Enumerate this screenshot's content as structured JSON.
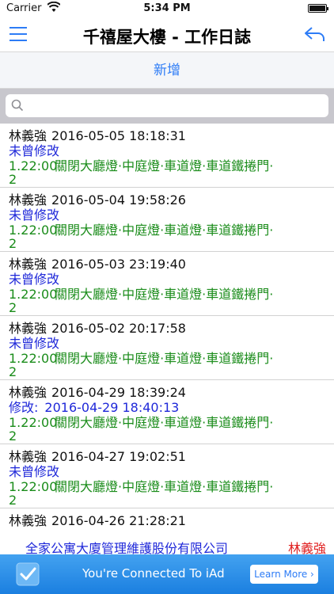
{
  "status_bar": {
    "carrier": "Carrier",
    "time": "5:34 PM"
  },
  "nav": {
    "title": "千禧屋大樓 - 工作日誌"
  },
  "add_button": "新增",
  "search": {
    "placeholder": ""
  },
  "entries": [
    {
      "name": "林義強",
      "datetime": "2016-05-05 18:18:31",
      "mod_label": "未曾修改",
      "mod_time": "",
      "version": "1.22:00",
      "task": "關閉大廳燈·中庭燈·車道燈·車道鐵捲門·",
      "count": "2"
    },
    {
      "name": "林義強",
      "datetime": "2016-05-04 19:58:26",
      "mod_label": "未曾修改",
      "mod_time": "",
      "version": "1.22:00",
      "task": "關閉大廳燈·中庭燈·車道燈·車道鐵捲門·",
      "count": "2"
    },
    {
      "name": "林義強",
      "datetime": "2016-05-03 23:19:40",
      "mod_label": "未曾修改",
      "mod_time": "",
      "version": "1.22:00",
      "task": "關閉大廳燈·中庭燈·車道燈·車道鐵捲門·",
      "count": "2"
    },
    {
      "name": "林義強",
      "datetime": "2016-05-02 20:17:58",
      "mod_label": "未曾修改",
      "mod_time": "",
      "version": "1.22:00",
      "task": "關閉大廳燈·中庭燈·車道燈·車道鐵捲門·",
      "count": "2"
    },
    {
      "name": "林義強",
      "datetime": "2016-04-29 18:39:24",
      "mod_label": "修改:",
      "mod_time": "2016-04-29 18:40:13",
      "version": "1.22:00",
      "task": "關閉大廳燈·中庭燈·車道燈·車道鐵捲門·",
      "count": "2"
    },
    {
      "name": "林義強",
      "datetime": "2016-04-27 19:02:51",
      "mod_label": "未曾修改",
      "mod_time": "",
      "version": "1.22:00",
      "task": "關閉大廳燈·中庭燈·車道燈·車道鐵捲門·",
      "count": "2"
    },
    {
      "name": "林義強",
      "datetime": "2016-04-26 21:28:21",
      "mod_label": "",
      "mod_time": "",
      "version": "",
      "task": "",
      "count": ""
    }
  ],
  "footer": {
    "company": "全家公寓大廈管理維護股份有限公司",
    "user": "林義強"
  },
  "iad": {
    "text": "You're Connected To iAd",
    "button": "Learn More ›"
  },
  "colors": {
    "accent": "#2d7cf6",
    "modified_blue": "#1f28d9",
    "task_green": "#1a8c1a",
    "user_red": "#e02020"
  }
}
